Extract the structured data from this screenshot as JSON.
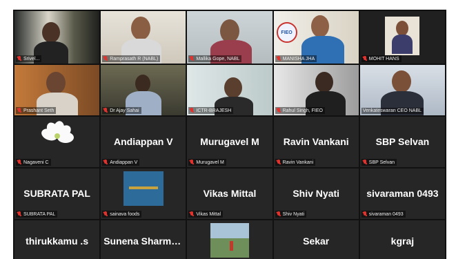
{
  "participants": [
    {
      "name": "Srivel...",
      "type": "video"
    },
    {
      "name": "Ramprasath R (NABL)",
      "type": "video"
    },
    {
      "name": "Mallika Gope, NABL",
      "type": "video"
    },
    {
      "name": "MANISHA JHA",
      "type": "video",
      "badge": "FIEO"
    },
    {
      "name": "MOHIT HANS",
      "type": "video"
    },
    {
      "name": "Prashant Seth",
      "type": "video"
    },
    {
      "name": "Dr Ajay Sahai",
      "type": "video"
    },
    {
      "name": "ICTR-BRAJESH",
      "type": "video"
    },
    {
      "name": "Rahul Singh, FIEO",
      "type": "video"
    },
    {
      "name": "Venkateswaran CEO NABL",
      "type": "video",
      "speaking": true
    },
    {
      "name": "Nagaveni C",
      "type": "image-lily"
    },
    {
      "name": "Andiappan V",
      "display": "Andiappan V",
      "type": "name"
    },
    {
      "name": "Murugavel M",
      "display": "Murugavel M",
      "type": "name"
    },
    {
      "name": "Ravin Vankani",
      "display": "Ravin Vankani",
      "type": "name"
    },
    {
      "name": "SBP Selvan",
      "display": "SBP Selvan",
      "type": "name"
    },
    {
      "name": "SUBRATA PAL",
      "display": "SUBRATA PAL",
      "type": "name"
    },
    {
      "name": "sainava foods",
      "type": "image-food"
    },
    {
      "name": "Vikas Mittal",
      "display": "Vikas Mittal",
      "type": "name"
    },
    {
      "name": "Shiv Nyati",
      "display": "Shiv Nyati",
      "type": "name"
    },
    {
      "name": "sivaraman 0493",
      "display": "sivaraman 0493",
      "type": "name"
    },
    {
      "name": "",
      "display": "thirukkamu .s",
      "type": "name"
    },
    {
      "name": "",
      "display": "Sunena Sharma...",
      "type": "name"
    },
    {
      "name": "",
      "type": "image-park"
    },
    {
      "name": "",
      "display": "Sekar",
      "type": "name"
    },
    {
      "name": "",
      "display": "kgraj",
      "type": "name"
    }
  ],
  "colors": {
    "speaking_outline": "#9bd23c",
    "muted_mic": "#e0332e"
  }
}
